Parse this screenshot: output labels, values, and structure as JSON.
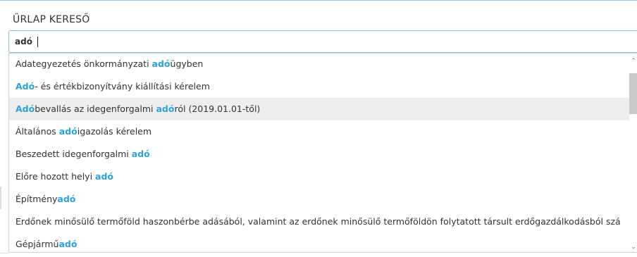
{
  "panel": {
    "title": "ŰRLAP KERESŐ"
  },
  "search": {
    "value": "adó",
    "highlight_color": "#2aa3d8"
  },
  "results": [
    {
      "parts": [
        {
          "t": "Adategyezetés önkormányzati ",
          "h": false
        },
        {
          "t": "adó",
          "h": true
        },
        {
          "t": "ügyben",
          "h": false
        }
      ]
    },
    {
      "parts": [
        {
          "t": "Adó",
          "h": true
        },
        {
          "t": "- és értékbizonyítvány kiállítási kérelem",
          "h": false
        }
      ]
    },
    {
      "parts": [
        {
          "t": "Adó",
          "h": true
        },
        {
          "t": "bevallás az idegenforgalmi ",
          "h": false
        },
        {
          "t": "adó",
          "h": true
        },
        {
          "t": "ról (2019.01.01-től)",
          "h": false
        }
      ],
      "active": true
    },
    {
      "parts": [
        {
          "t": "Általános ",
          "h": false
        },
        {
          "t": "adó",
          "h": true
        },
        {
          "t": "igazolás kérelem",
          "h": false
        }
      ]
    },
    {
      "parts": [
        {
          "t": "Beszedett idegenforgalmi ",
          "h": false
        },
        {
          "t": "adó",
          "h": true
        }
      ]
    },
    {
      "parts": [
        {
          "t": "Előre hozott helyi ",
          "h": false
        },
        {
          "t": "adó",
          "h": true
        }
      ]
    },
    {
      "parts": [
        {
          "t": "Építmény",
          "h": false
        },
        {
          "t": "adó",
          "h": true
        }
      ]
    },
    {
      "parts": [
        {
          "t": "Erdőnek minősülő termőföld haszonbérbe adásából, valamint az erdőnek minősülő termőföldön folytatott társult erdőgazdálkodásból szá",
          "h": false
        }
      ]
    },
    {
      "parts": [
        {
          "t": "Gépjármű",
          "h": false
        },
        {
          "t": "adó",
          "h": true
        }
      ]
    }
  ],
  "scrollbar": {
    "up_icon": "chevron-up-icon",
    "down_icon": "chevron-down-icon"
  }
}
